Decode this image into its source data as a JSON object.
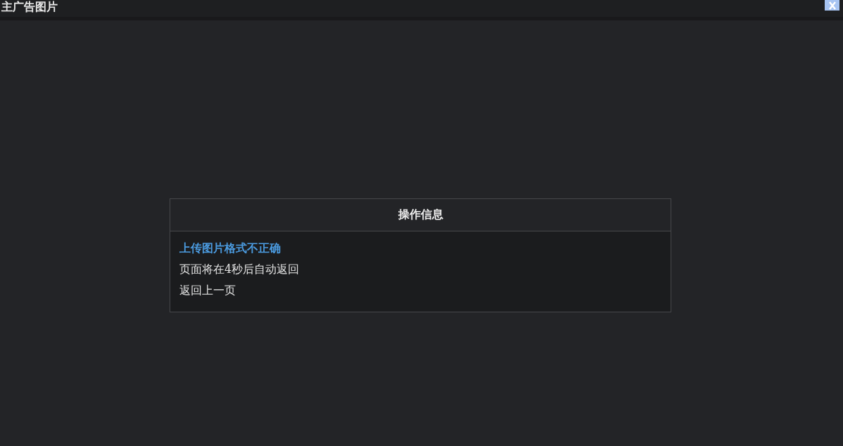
{
  "window": {
    "title": "主广告图片"
  },
  "dialog": {
    "title": "操作信息",
    "messages": [
      {
        "kind": "error",
        "text": "上传图片格式不正确"
      },
      {
        "kind": "info",
        "text": "页面将在4秒后自动返回"
      },
      {
        "kind": "link",
        "text": "返回上一页"
      }
    ]
  }
}
